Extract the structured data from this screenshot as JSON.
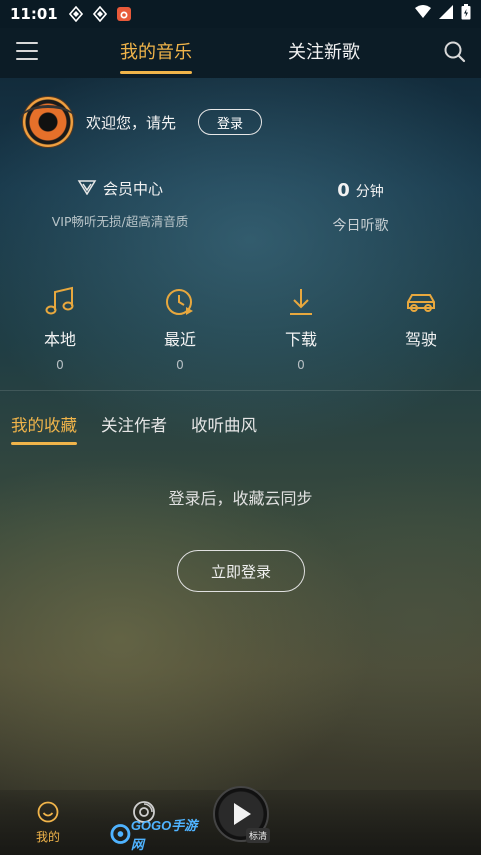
{
  "status_bar": {
    "time": "11:01",
    "icons": [
      "app-notify-icon-1",
      "app-notify-icon-2",
      "camera-app-icon",
      "wifi-icon",
      "signal-icon",
      "battery-icon"
    ]
  },
  "top_nav": {
    "tabs": [
      {
        "label": "我的音乐",
        "active": true
      },
      {
        "label": "关注新歌",
        "active": false
      }
    ],
    "menu_icon": "hamburger-menu-icon",
    "search_icon": "search-icon"
  },
  "user": {
    "welcome_text": "欢迎您，请先",
    "login_label": "登录"
  },
  "vip": {
    "title": "会员中心",
    "subtitle": "VIP畅听无损/超高清音质"
  },
  "listen_time": {
    "value": "0",
    "unit": "分钟",
    "label": "今日听歌"
  },
  "quick_access": [
    {
      "label": "本地",
      "count": "0",
      "icon": "music-note-icon"
    },
    {
      "label": "最近",
      "count": "0",
      "icon": "clock-play-icon"
    },
    {
      "label": "下载",
      "count": "0",
      "icon": "download-icon"
    },
    {
      "label": "驾驶",
      "count": "",
      "icon": "car-icon"
    }
  ],
  "sub_tabs": [
    {
      "label": "我的收藏",
      "active": true
    },
    {
      "label": "关注作者",
      "active": false
    },
    {
      "label": "收听曲风",
      "active": false
    }
  ],
  "empty_state": {
    "message": "登录后，收藏云同步",
    "button_label": "立即登录"
  },
  "bottom_nav": {
    "tabs": [
      {
        "label": "我的",
        "active": true,
        "icon": "smile-face-icon"
      },
      {
        "label": "",
        "active": false,
        "icon": "disc-icon"
      }
    ],
    "player_icon": "play-icon",
    "quality_badge": "标清"
  },
  "watermark": {
    "text": "GOGO手游网"
  },
  "colors": {
    "accent": "#f0b44a",
    "text": "#ffffff",
    "subtext": "#b8c4c8",
    "topbar": "#0c1c26"
  }
}
